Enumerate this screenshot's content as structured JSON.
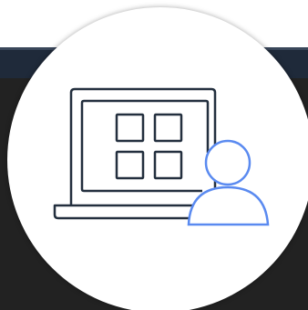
{
  "colors": {
    "header_band": "#1f2a3a",
    "header_band_highlight": "#3a475a",
    "dark_panel": "#222222",
    "badge_background": "#ffffff",
    "laptop_stroke": "#232f3e",
    "person_stroke": "#5a8af0"
  },
  "icons": {
    "laptop": "laptop-icon",
    "app_grid": "app-grid-icon",
    "user": "user-icon"
  }
}
